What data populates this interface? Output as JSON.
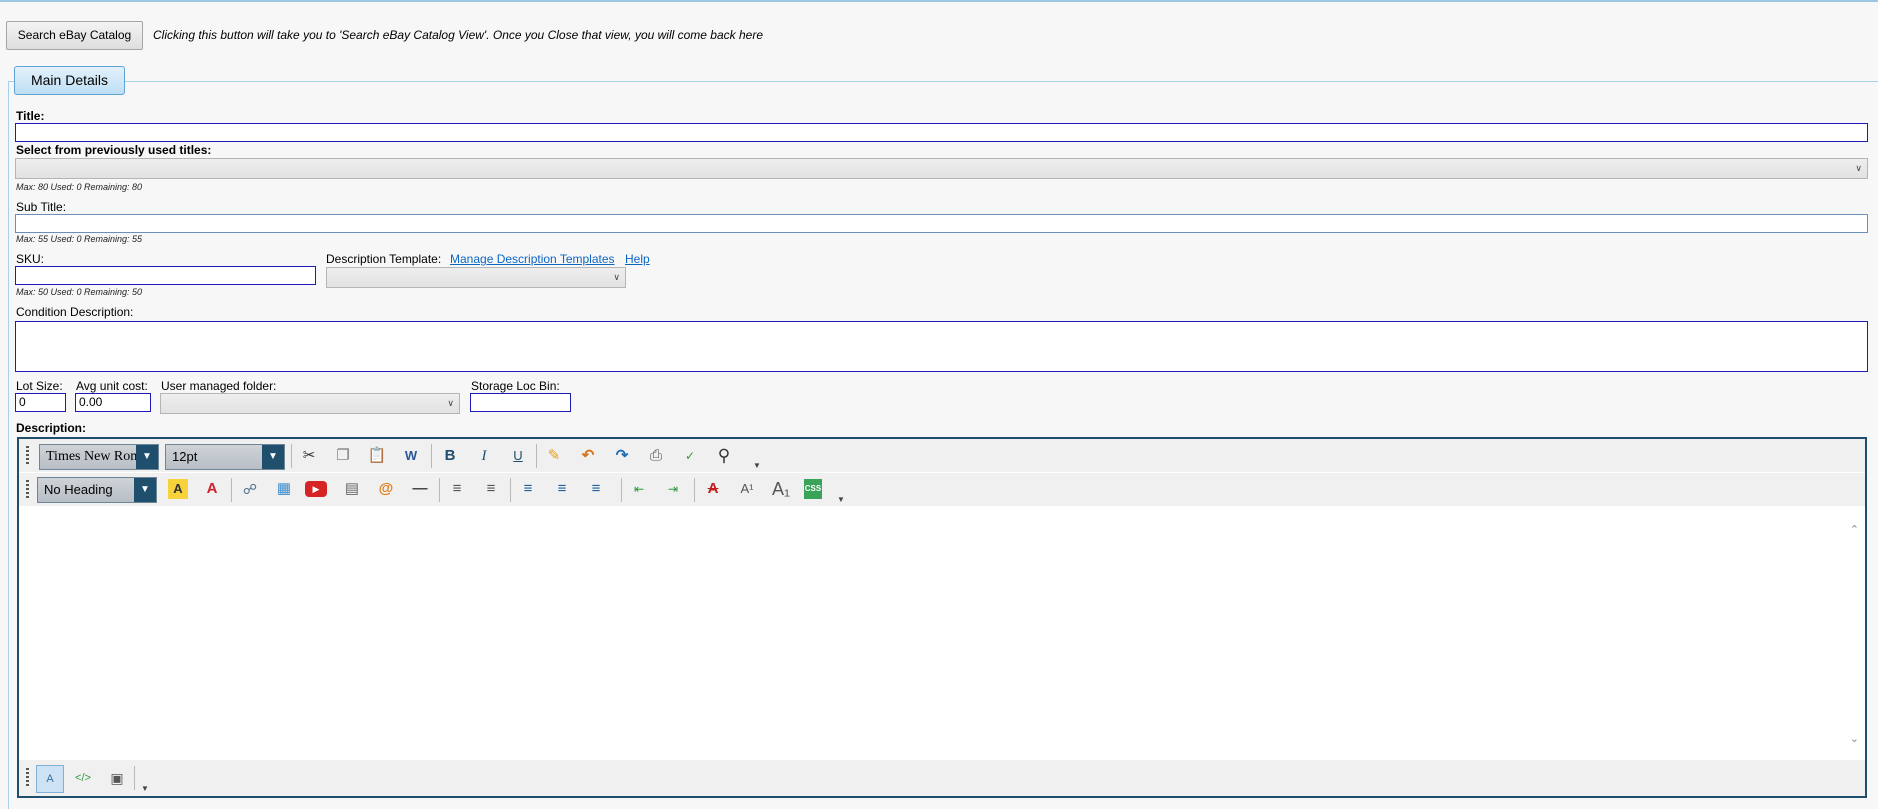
{
  "header": {
    "catalog_button": "Search eBay Catalog",
    "catalog_hint": "Clicking this button will take you to 'Search eBay Catalog View'. Once you Close that view, you will come back here"
  },
  "tab": {
    "main_details": "Main Details"
  },
  "form": {
    "title_label": "Title:",
    "title_value": "",
    "prev_titles_label": "Select from previously used titles:",
    "prev_titles_value": "",
    "title_counter": "Max: 80 Used: 0 Remaining: 80",
    "subtitle_label": "Sub Title:",
    "subtitle_value": "",
    "subtitle_counter": "Max: 55 Used: 0 Remaining: 55",
    "sku_label": "SKU:",
    "sku_value": "",
    "sku_counter": "Max: 50 Used: 0 Remaining: 50",
    "desc_template_label": "Description Template:",
    "manage_templates_link": "Manage Description Templates",
    "help_link": "Help",
    "condition_label": "Condition Description:",
    "condition_value": "",
    "lot_size_label": "Lot Size:",
    "lot_size_value": "0",
    "avg_cost_label": "Avg unit cost:",
    "avg_cost_value": "0.00",
    "folder_label": "User managed folder:",
    "storage_label": "Storage Loc Bin:",
    "storage_value": "",
    "description_label": "Description:"
  },
  "editor": {
    "font_family": "Times New Roman",
    "font_size": "12pt",
    "heading": "No Heading",
    "toolbar1_icons": [
      "cut-icon",
      "copy-icon",
      "paste-icon",
      "paste-word-icon",
      "bold-icon",
      "italic-icon",
      "underline-icon",
      "eraser-icon",
      "undo-icon",
      "redo-icon",
      "print-icon",
      "spellcheck-icon",
      "find-icon"
    ],
    "toolbar2_icons": [
      "highlight-icon",
      "font-color-icon",
      "link-icon",
      "image-icon",
      "video-icon",
      "table-icon",
      "email-icon",
      "horizontal-rule-icon",
      "ordered-list-icon",
      "unordered-list-icon",
      "align-left-icon",
      "align-center-icon",
      "align-right-icon",
      "outdent-icon",
      "indent-icon",
      "strikethrough-icon",
      "superscript-icon",
      "subscript-icon",
      "css-icon"
    ],
    "bottom_icons": [
      "design-view-icon",
      "html-view-icon",
      "preview-icon"
    ]
  },
  "colors": {
    "accent": "#1f4f6d",
    "input_border": "#1c1cb3",
    "link": "#0b66c2"
  }
}
